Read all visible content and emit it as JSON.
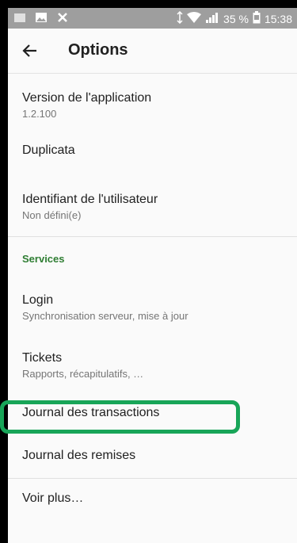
{
  "statusbar": {
    "icons": [
      "sim-icon",
      "image-icon",
      "x-icon"
    ],
    "battery_text": "35 %",
    "time": "15:38"
  },
  "appbar": {
    "title": "Options"
  },
  "items": [
    {
      "title": "Version de l'application",
      "subtitle": "1.2.100"
    },
    {
      "title": "Duplicata"
    },
    {
      "title": "Identifiant de l'utilisateur",
      "subtitle": "Non défini(e)"
    }
  ],
  "section": {
    "label": "Services"
  },
  "services": [
    {
      "title": "Login",
      "subtitle": "Synchronisation serveur, mise à jour"
    },
    {
      "title": "Tickets",
      "subtitle": "Rapports, récapitulatifs, …"
    },
    {
      "title": "Journal des transactions"
    },
    {
      "title": "Journal des remises"
    }
  ],
  "more": {
    "title": "Voir plus…"
  },
  "colors": {
    "highlight": "#18a558",
    "section": "#2e7d32",
    "statusbar": "#9e9e9e"
  }
}
